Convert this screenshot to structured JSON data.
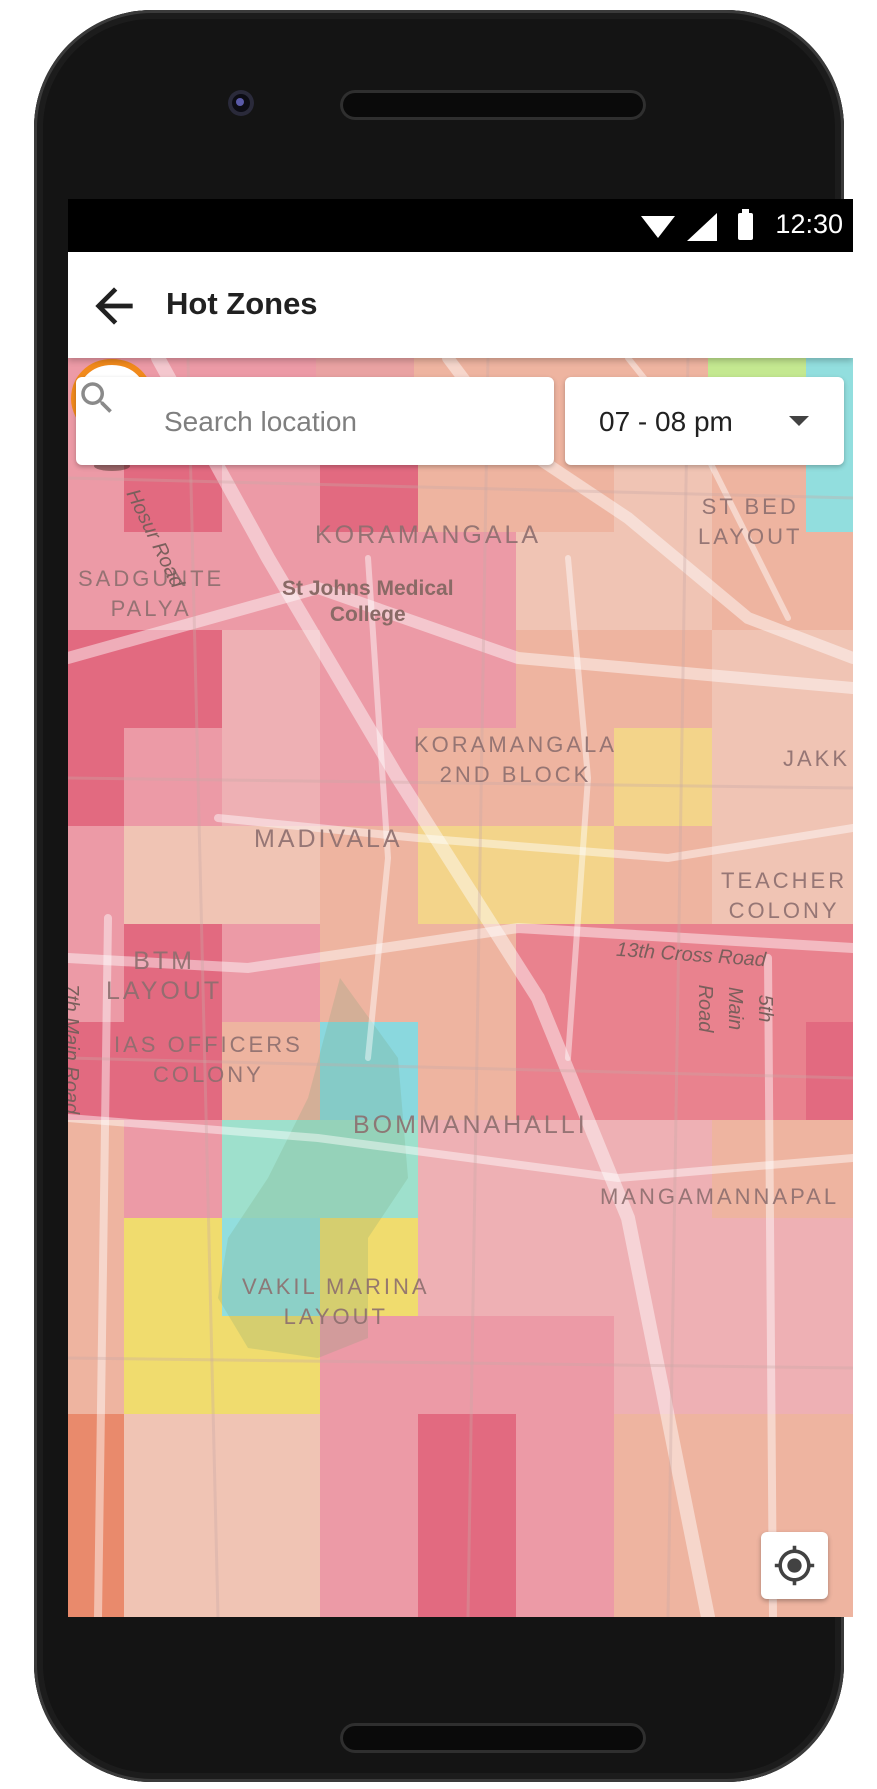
{
  "status_bar": {
    "time": "12:30"
  },
  "app_bar": {
    "title": "Hot Zones",
    "back_icon": "arrow-left-icon"
  },
  "search": {
    "placeholder": "Search location",
    "icon": "search-icon"
  },
  "time_filter": {
    "selected": "07 - 08 pm",
    "icon": "caret-down-icon"
  },
  "map": {
    "labels": {
      "koramangala": "KORAMANGALA",
      "st_bed_layout": "ST BED\nLAYOUT",
      "sadgunte_palya": "SADGUNTE\nPALYA",
      "st_johns": "St Johns Medical\nCollege",
      "koramangala_2nd_block": "KORAMANGALA\n2ND BLOCK",
      "jakk": "JAKK",
      "madivala": "MADIVALA",
      "teacher_colony": "TEACHER\nCOLONY",
      "btm_layout": "BTM\nLAYOUT",
      "ias_officers_colony": "IAS OFFICERS\nCOLONY",
      "bommanahalli": "BOMMANAHALLI",
      "mangamannapal": "MANGAMANNAPAL",
      "vakil_marina_layout": "VAKIL MARINA\nLAYOUT",
      "hosur_road": "Hosur Road",
      "thirteenth_cross_road": "13th Cross Road",
      "fifth_main_road": "5th Main Road",
      "seventh_main_road": "7th Main Road"
    },
    "zone_colors": {
      "very_high": "#e26a80",
      "high": "#ec9aa6",
      "medium_high": "#eeb0b4",
      "medium": "#eeb4a0",
      "low": "#f3d48a",
      "very_low": "#f0dc6e",
      "none": "#92dede",
      "green": "#c4e890"
    },
    "marker_icon": "delivery-scooter-pin-icon",
    "marker_color": "#f18a1c"
  },
  "locate_button": {
    "icon": "my-location-icon"
  }
}
